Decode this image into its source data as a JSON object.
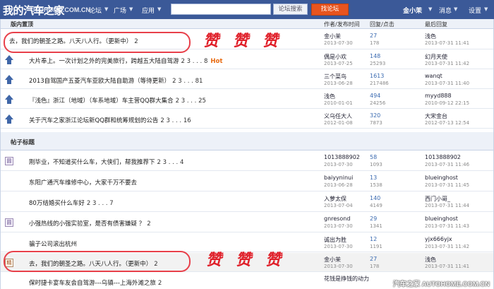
{
  "topbar": {
    "logo": "我的汽车之家",
    "url": "UTOHOME.COM.CN",
    "nav": [
      "论坛",
      "广场",
      "应用"
    ],
    "search_placeholder": "",
    "search_button": "论坛搜索",
    "find_button": "找论坛",
    "user": "金小茉",
    "messages": "消息",
    "settings": "设置"
  },
  "header": {
    "section": "版内置顶",
    "author_col": "作者/发布时间",
    "reply_col": "回复/点击",
    "last_col": "最后回复"
  },
  "pinned": [
    {
      "title": "去，我们的朝圣之路。八天八人行。（更新中）",
      "pages": "2",
      "author": "金小茉",
      "date": "2013-07-30",
      "replies": "27",
      "views": "178",
      "last_user": "浅色",
      "last_date": "2013-07-31 11:41",
      "circled": true
    },
    {
      "title": "大片奉上。一次计划之外的完美旅行，跨越五大陆自驾游",
      "pages": "2 3 . . . 8",
      "hot": "Hot",
      "author": "偶是小欢",
      "date": "2013-07-25",
      "replies": "148",
      "views": "25293",
      "last_user": "幻月天使",
      "last_date": "2013-07-31 11:42"
    },
    {
      "title": "2013自驾国产五菱汽车亚欧大陆自助游（等待更新）",
      "pages": "2 3 . . . 81",
      "author": "三个菜鸟",
      "date": "2013-06-28",
      "replies": "1613",
      "views": "217486",
      "last_user": "wanqt",
      "last_date": "2013-07-31 11:40"
    },
    {
      "title": "『浅色』浙江（地域）（车系地域）车主营QQ群大集合",
      "pages": "2 3 . . . 25",
      "author": "浅色",
      "date": "2010-01-01",
      "replies": "494",
      "views": "24256",
      "last_user": "myyd888",
      "last_date": "2010-09-12 22:15"
    },
    {
      "title": "关于汽车之家浙江论坛新QQ群和统筹规划的公告",
      "pages": "2 3 . . . 16",
      "author": "义乌任大人",
      "date": "2012-01-08",
      "replies": "320",
      "views": "7873",
      "last_user": "大宋金台",
      "last_date": "2012-07-13 12:54"
    }
  ],
  "posts_section": "帖子标题",
  "posts": [
    {
      "icon": "box",
      "title": "刚毕业，不知道买什么车，大侠们，帮我推荐下",
      "pages": "2 3 . . . 4",
      "author": "1013888902",
      "date": "2013-07-30",
      "replies": "58",
      "views": "1093",
      "last_user": "1013888902",
      "last_date": "2013-07-31 11:46"
    },
    {
      "icon": "none",
      "title": "东阳广通汽车维修中心，大家千万不要去",
      "pages": "",
      "author": "baiyyninui",
      "date": "2013-06-28",
      "replies": "13",
      "views": "1538",
      "last_user": "blueinghost",
      "last_date": "2013-07-31 11:45"
    },
    {
      "icon": "none",
      "title": "80万结婚买什么车好",
      "pages": "2 3 . . . 7",
      "author": "入萝太保",
      "date": "2013-07-04",
      "replies": "140",
      "views": "4149",
      "last_user": "西门小哥_",
      "last_date": "2013-07-31 11:44"
    },
    {
      "icon": "box",
      "title": "小强热线的小强实验室，是否有债害嫌疑 ？",
      "pages": "2",
      "author": "gnresond",
      "date": "2013-07-30",
      "replies": "29",
      "views": "1341",
      "last_user": "blueinghost",
      "last_date": "2013-07-31 11:43"
    },
    {
      "icon": "none",
      "title": "骗子公司滚出杭州",
      "pages": "",
      "author": "诚出为胜",
      "date": "2013-07-30",
      "replies": "12",
      "views": "1191",
      "last_user": "yjx666yjx",
      "last_date": "2013-07-31 11:42"
    },
    {
      "icon": "jing",
      "jing_label": "精",
      "title": "去，我们的朝圣之路。八天八人行。（更新中）",
      "pages": "2",
      "author": "金小茉",
      "date": "2013-07-30",
      "replies": "27",
      "views": "178",
      "last_user": "浅色",
      "last_date": "2013-07-31 11:41",
      "circled": true
    },
    {
      "icon": "none",
      "title": "保时捷卡宴车友会自驾游---乌镇---上海外滩之旅",
      "pages": "2",
      "author": "花钱是挣钱的动力",
      "date": "2013-07-30",
      "replies": "",
      "views": "",
      "last_user": "",
      "last_date": ""
    }
  ],
  "box_label": "圆",
  "praise": "赞",
  "watermark": "汽车之家  AUTOHOME.COM.CN"
}
